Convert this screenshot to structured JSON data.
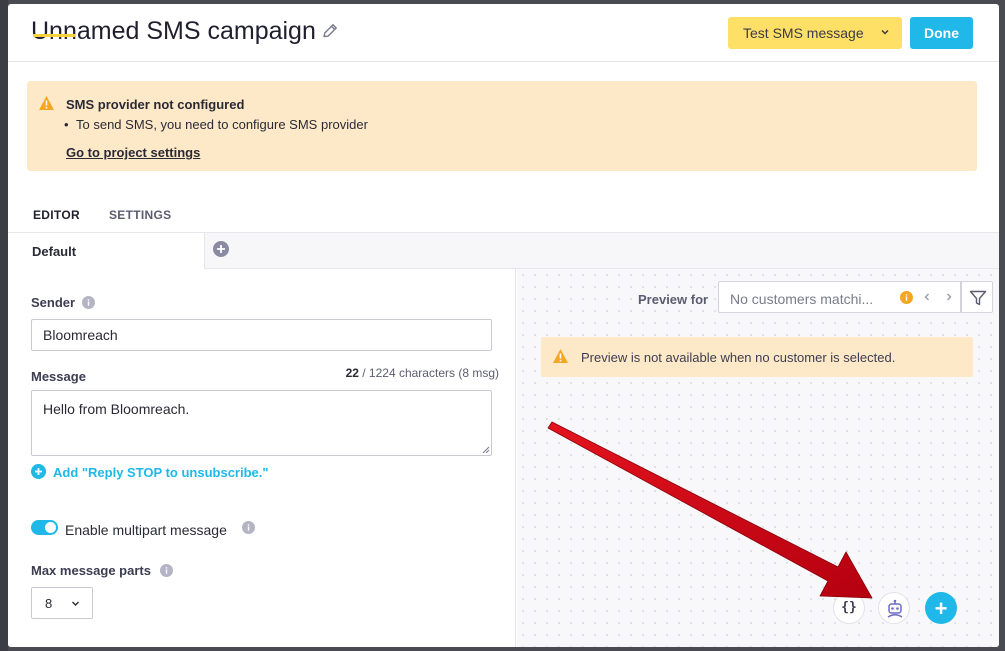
{
  "header": {
    "title": "Unnamed SMS campaign",
    "test_button_label": "Test SMS message",
    "done_button_label": "Done"
  },
  "warning": {
    "title": "SMS provider not configured",
    "bullet": "To send SMS, you need to configure SMS provider",
    "link": "Go to project settings"
  },
  "tabs": [
    {
      "label": "EDITOR",
      "active": true
    },
    {
      "label": "SETTINGS",
      "active": false
    }
  ],
  "variant": {
    "label": "Default"
  },
  "form": {
    "sender_label": "Sender",
    "sender_value": "Bloomreach",
    "message_label": "Message",
    "char_count": "22",
    "char_total": "/ 1224 characters",
    "msg_count": "(8 msg)",
    "message_value": "Hello from Bloomreach.",
    "reply_link": "Add \"Reply STOP to unsubscribe.\"",
    "multipart_label": "Enable multipart message",
    "multipart_enabled": true,
    "max_parts_label": "Max message parts",
    "max_parts_value": "8"
  },
  "preview": {
    "label": "Preview for",
    "placeholder": "No customers matchi...",
    "notice": "Preview is not available when no customer is selected."
  },
  "fabs": {
    "code_glyph": "{}"
  },
  "colors": {
    "accent": "#1fb8e8",
    "warning_bg": "#fde9c8",
    "test_button": "#ffe066",
    "warning_icon": "#f5a623",
    "annotation_arrow": "#d0021b"
  }
}
